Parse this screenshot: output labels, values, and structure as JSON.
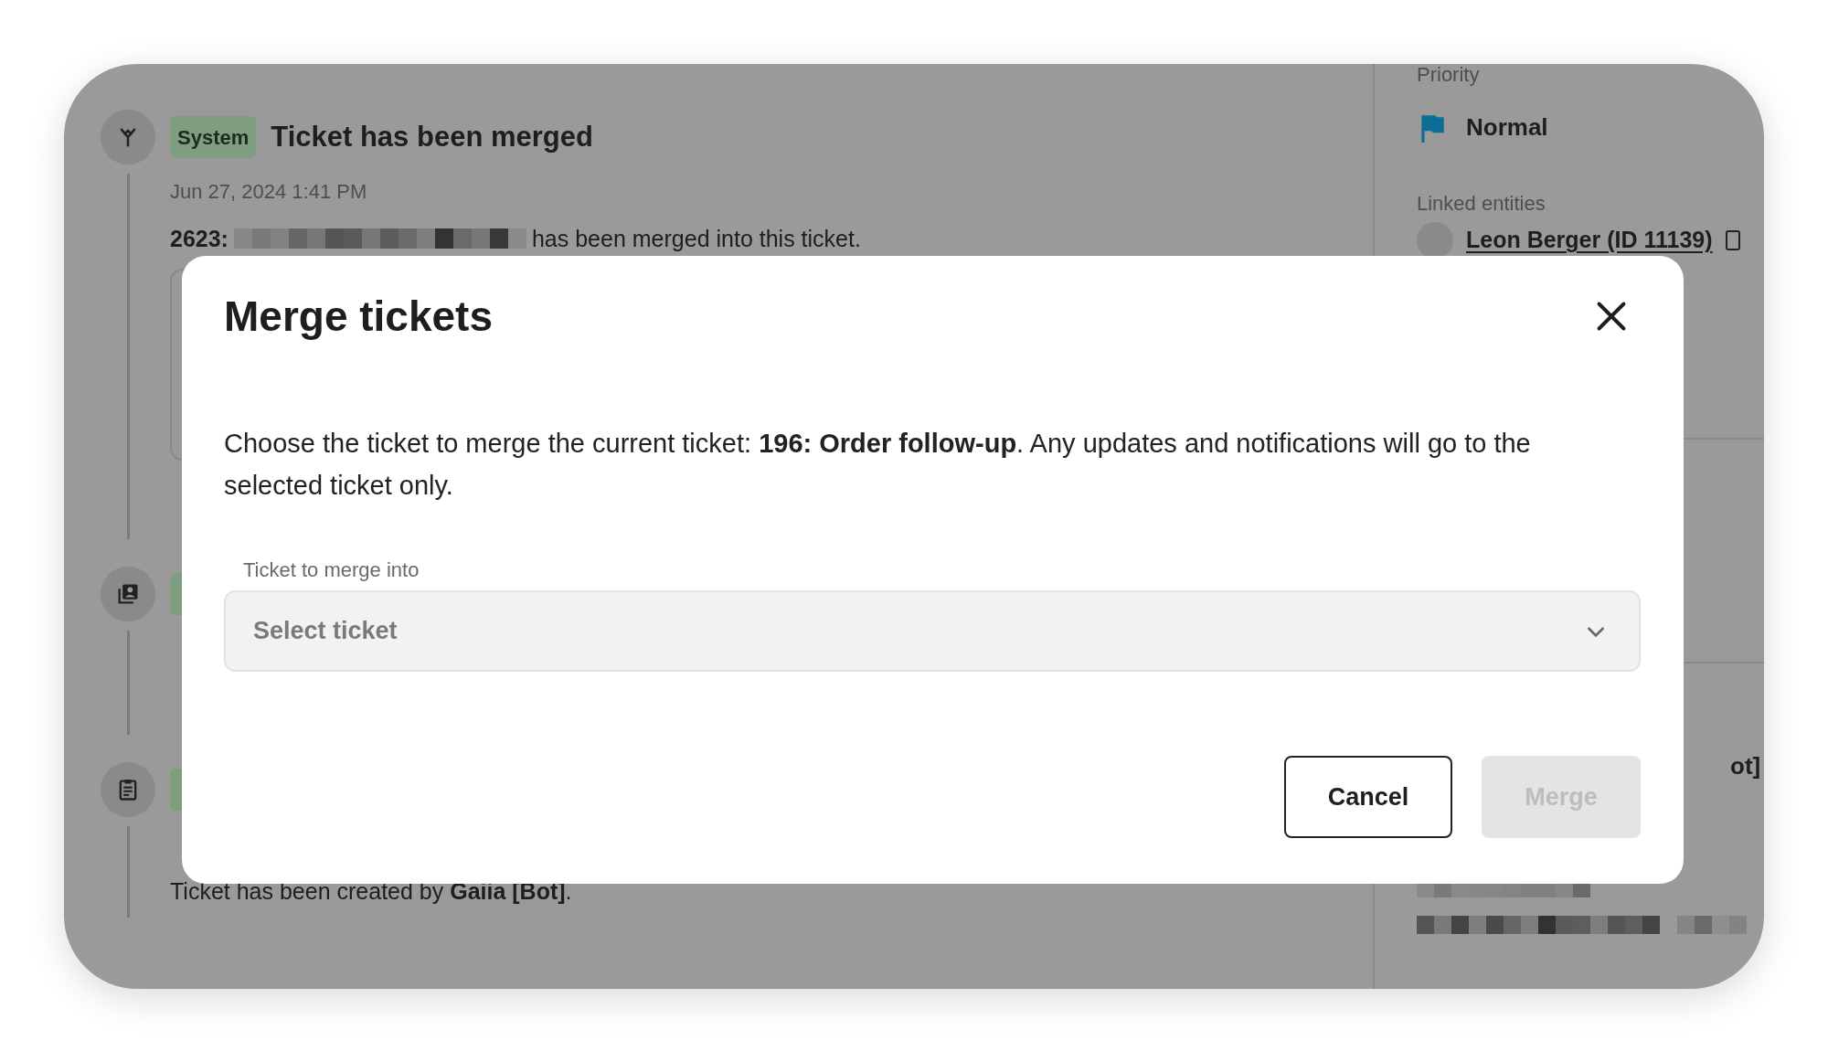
{
  "timeline": [
    {
      "kind": "merge",
      "badge": "System",
      "title": "Ticket has been merged",
      "date": "Jun 27, 2024 1:41 PM",
      "body_prefix": "2623:",
      "body": "has been merged into this ticket."
    },
    {
      "kind": "contact"
    },
    {
      "kind": "clipboard",
      "body": "Ticket has been created by **Gaiia [Bot]**."
    }
  ],
  "sidebar": {
    "priority_label": "Priority",
    "priority": "Normal",
    "linked_label": "Linked entities",
    "linked_entity": "Leon Berger (ID 11139)",
    "cut_text": "ot]"
  },
  "modal": {
    "title": "Merge tickets",
    "message": "Choose the ticket to merge the current ticket: **196: Order follow-up**. Any updates and notifications will go to the selected ticket only.",
    "field_label": "Ticket to merge into",
    "placeholder": "Select ticket",
    "buttons": [
      {
        "label": "Cancel",
        "kind": "secondary",
        "disabled": false
      },
      {
        "label": "Merge",
        "kind": "primary",
        "disabled": true
      }
    ]
  }
}
